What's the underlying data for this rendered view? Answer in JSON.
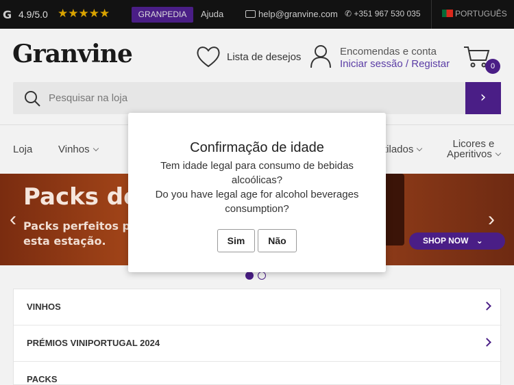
{
  "topbar": {
    "google_glyph": "G",
    "rating": "4.9/5.0",
    "stars": "★★★★★",
    "granpedia": "GRANPEDIA",
    "help": "Ajuda",
    "email": "help@granvine.com",
    "phone": "+351 967 530 035",
    "language": "PORTUGUÊS"
  },
  "header": {
    "logo": "Granvine",
    "wishlist": "Lista de desejos",
    "account_title": "Encomendas e conta",
    "login": "Iniciar sessão",
    "separator": "/",
    "register": "Registar",
    "cart_count": "0"
  },
  "search": {
    "placeholder": "Pesquisar na loja",
    "submit": "›"
  },
  "nav": {
    "items": [
      {
        "label": "Loja"
      },
      {
        "label": "Vinhos"
      },
      {
        "label": "tilados"
      },
      {
        "label": "Licores e"
      },
      {
        "label": "Aperitivos"
      }
    ]
  },
  "banner": {
    "headline": "Packs de",
    "sub_line1": "Packs perfeitos pa",
    "sub_line2": "esta estação.",
    "cta": "SHOP NOW",
    "prev": "‹",
    "next": "›"
  },
  "categories": [
    {
      "label": "VINHOS"
    },
    {
      "label": "PRÉMIOS VINIPORTUGAL 2024"
    },
    {
      "label": "PACKS"
    }
  ],
  "modal": {
    "title": "Confirmação de idade",
    "line1": "Tem idade legal para consumo de bebidas alcoólicas?",
    "line2": "Do you have legal age for alcohol beverages consumption?",
    "yes": "Sim",
    "no": "Não"
  },
  "colors": {
    "brand": "#4a1e86",
    "topbar": "#121212",
    "stars": "#d9a300"
  }
}
